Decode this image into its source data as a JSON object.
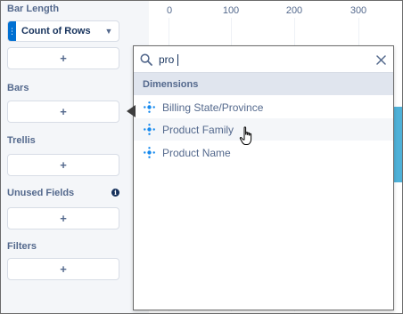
{
  "left_panel": {
    "bar_length": {
      "label": "Bar Length",
      "pill": {
        "label": "Count of Rows",
        "icon": "chevron-down-icon"
      }
    },
    "sections": [
      {
        "label": "Bars",
        "add": "+"
      },
      {
        "label": "Trellis",
        "add": "+"
      },
      {
        "label": "Unused Fields",
        "add": "+",
        "icon": "info-icon"
      },
      {
        "label": "Filters",
        "add": "+"
      }
    ],
    "bar_length_add": "+",
    "info_glyph": "i"
  },
  "chart": {
    "axis_ticks": [
      "0",
      "100",
      "200",
      "300"
    ],
    "bar_color": "#4fb1d8"
  },
  "dropdown": {
    "search": {
      "value": "pro",
      "icon": "search-icon",
      "clear_icon": "close-icon"
    },
    "group_header": "Dimensions",
    "options": [
      {
        "label": "Billing State/Province",
        "icon": "dimension-icon"
      },
      {
        "label": "Product Family",
        "icon": "dimension-icon",
        "hovered": true
      },
      {
        "label": "Product Name",
        "icon": "dimension-icon"
      }
    ]
  },
  "colors": {
    "accent": "#0070d2",
    "dimension_icon": "#1589ee",
    "text_label": "#54698d",
    "text_primary": "#16325c",
    "header_bg": "#e0e5ee"
  }
}
